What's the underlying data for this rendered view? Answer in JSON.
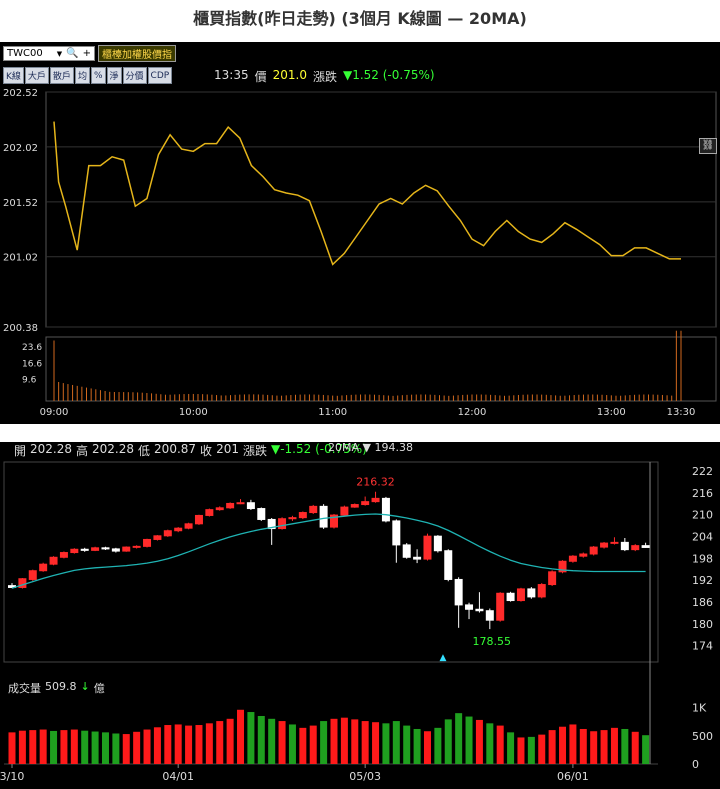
{
  "page_title": "櫃買指數(昨日走勢) (3個月 K線圖  — 20MA)",
  "intraday": {
    "symbol": "TWC00",
    "board_button": "櫃檯加權股價指",
    "tabs": [
      "K線",
      "大戶",
      "散戶",
      "均",
      "%",
      "淨",
      "分價",
      "CDP"
    ],
    "time_label": "13:35",
    "price_label": "價",
    "price_value": "201.0",
    "change_label": "漲跌",
    "change_value": "▼1.52 (-0.75%)",
    "link_icon": "link-icon"
  },
  "kline": {
    "open_label": "開",
    "open_value": "202.28",
    "high_label": "高",
    "high_value": "202.28",
    "low_label": "低",
    "low_value": "200.87",
    "close_label": "收",
    "close_value": "201",
    "change_label": "漲跌",
    "change_value": "▼-1.52 (-0.75%)",
    "ma_label": "20MA ▼ 194.38",
    "vol_label": "成交量",
    "vol_value": "509.8",
    "vol_arrow": "↓",
    "vol_unit": "億"
  },
  "chart_data": [
    {
      "type": "line",
      "title": "intraday",
      "y_ticks": [
        "202.52",
        "202.02",
        "201.52",
        "201.02",
        "200.38"
      ],
      "ylim": [
        200.38,
        202.52
      ],
      "x_ticks": [
        "09:00",
        "10:00",
        "11:00",
        "12:00",
        "13:00",
        "13:30"
      ],
      "x": [
        0,
        2,
        5,
        10,
        15,
        20,
        25,
        30,
        35,
        40,
        45,
        50,
        55,
        60,
        65,
        70,
        75,
        80,
        85,
        90,
        95,
        100,
        105,
        110,
        115,
        120,
        125,
        130,
        135,
        140,
        145,
        150,
        155,
        160,
        165,
        170,
        175,
        180,
        185,
        190,
        195,
        200,
        205,
        210,
        215,
        220,
        225,
        230,
        235,
        240,
        245,
        250,
        255,
        260,
        265,
        270
      ],
      "y": [
        202.25,
        201.7,
        201.48,
        201.08,
        201.85,
        201.85,
        201.93,
        201.9,
        201.48,
        201.55,
        201.95,
        202.13,
        202.0,
        201.98,
        202.05,
        202.05,
        202.2,
        202.1,
        201.85,
        201.75,
        201.63,
        201.6,
        201.58,
        201.53,
        201.25,
        200.95,
        201.05,
        201.2,
        201.35,
        201.5,
        201.55,
        201.5,
        201.6,
        201.67,
        201.62,
        201.48,
        201.35,
        201.18,
        201.12,
        201.25,
        201.35,
        201.25,
        201.18,
        201.15,
        201.23,
        201.33,
        201.27,
        201.2,
        201.13,
        201.03,
        201.03,
        201.1,
        201.1,
        201.05,
        201.0,
        201.0
      ],
      "volume_ticks": [
        "23.6",
        "16.6",
        "9.6"
      ],
      "volume_ylim": [
        0,
        27.5
      ],
      "volume_first": 26,
      "volume_last": 30.2
    },
    {
      "type": "candlestick",
      "title": "3個月 K線",
      "y_ticks": [
        "222",
        "216",
        "210",
        "204",
        "198",
        "192",
        "186",
        "180",
        "174"
      ],
      "ylim": [
        169.5,
        224.5
      ],
      "x_ticks": [
        "3/10",
        "04/01",
        "05/03",
        "06/01"
      ],
      "x_tick_index": [
        0,
        16,
        34,
        54
      ],
      "high_label": "216.32",
      "low_label": "178.55",
      "candles": [
        [
          190.5,
          190,
          191.2,
          189.8
        ],
        [
          190,
          192.4,
          192.6,
          189.7
        ],
        [
          192.2,
          194.6,
          194.9,
          191.8
        ],
        [
          194.6,
          196.4,
          196.8,
          194.3
        ],
        [
          196.4,
          198.3,
          198.6,
          196.1
        ],
        [
          198.3,
          199.6,
          199.9,
          198
        ],
        [
          199.6,
          200.5,
          200.8,
          199.3
        ],
        [
          200.5,
          200.2,
          200.9,
          199.8
        ],
        [
          200.2,
          200.9,
          201.2,
          200
        ],
        [
          200.9,
          200.6,
          201.2,
          200.3
        ],
        [
          200.6,
          200,
          200.9,
          199.6
        ],
        [
          200,
          201.1,
          201.3,
          199.8
        ],
        [
          201.1,
          201.3,
          201.6,
          200.7
        ],
        [
          201.3,
          203.2,
          203.4,
          201
        ],
        [
          203.2,
          204.2,
          204.4,
          202.9
        ],
        [
          204.2,
          205.6,
          205.9,
          203.9
        ],
        [
          205.6,
          206.3,
          206.6,
          205.2
        ],
        [
          206.3,
          207.5,
          207.8,
          206
        ],
        [
          207.5,
          209.8,
          210,
          207.2
        ],
        [
          209.8,
          211.4,
          211.7,
          209.5
        ],
        [
          211.4,
          211.9,
          212.3,
          211.1
        ],
        [
          211.9,
          213.1,
          213.4,
          211.6
        ],
        [
          213.1,
          213.3,
          214.3,
          212.9
        ],
        [
          213.3,
          211.7,
          214.1,
          211.3
        ],
        [
          211.7,
          208.7,
          212,
          208.3
        ],
        [
          208.7,
          206.2,
          209.1,
          201.7
        ],
        [
          206.2,
          208.9,
          209.3,
          205.9
        ],
        [
          208.9,
          209.2,
          209.7,
          208.3
        ],
        [
          209.2,
          210.6,
          210.9,
          208.8
        ],
        [
          210.6,
          212.3,
          212.7,
          210.2
        ],
        [
          212.3,
          206.6,
          212.9,
          206.1
        ],
        [
          206.6,
          209.9,
          210.2,
          206.2
        ],
        [
          209.9,
          212.1,
          212.5,
          209.5
        ],
        [
          212.1,
          212.8,
          213.1,
          211.9
        ],
        [
          212.8,
          213.6,
          215,
          212.5
        ],
        [
          213.6,
          214.5,
          216.32,
          213.3
        ],
        [
          214.5,
          208.3,
          214.9,
          207.9
        ],
        [
          208.3,
          201.7,
          208.7,
          196.8
        ],
        [
          201.7,
          198.3,
          202.2,
          197.9
        ],
        [
          198.3,
          197.8,
          200.5,
          196.7
        ],
        [
          197.8,
          204.1,
          204.8,
          197.4
        ],
        [
          204.1,
          200.1,
          204.4,
          199.6
        ],
        [
          200.1,
          192.2,
          200.5,
          191.7
        ],
        [
          192.2,
          185.2,
          192.8,
          178.9
        ],
        [
          185.2,
          184,
          185.8,
          181.3
        ],
        [
          184,
          183.6,
          188.7,
          183.1
        ],
        [
          183.6,
          181,
          184.2,
          178.55
        ],
        [
          181,
          188.4,
          188.7,
          180.6
        ],
        [
          188.4,
          186.4,
          188.8,
          186.1
        ],
        [
          186.4,
          189.6,
          189.9,
          186.1
        ],
        [
          189.6,
          187.4,
          190.1,
          186.9
        ],
        [
          187.4,
          190.8,
          191.2,
          187
        ],
        [
          190.8,
          194.3,
          194.7,
          190.4
        ],
        [
          194.3,
          197.2,
          197.5,
          193.9
        ],
        [
          197.2,
          198.6,
          198.9,
          196.8
        ],
        [
          198.6,
          199.2,
          199.6,
          198.2
        ],
        [
          199.2,
          201.1,
          201.4,
          198.8
        ],
        [
          201.1,
          202.2,
          202.5,
          200.7
        ],
        [
          202.2,
          202.4,
          203.8,
          201.8
        ],
        [
          202.4,
          200.4,
          203.6,
          200
        ],
        [
          200.4,
          201.5,
          201.9,
          200
        ],
        [
          201.5,
          201,
          202.3,
          200.9
        ]
      ],
      "ma20": [
        189.8,
        190.7,
        191.6,
        192.5,
        193.3,
        194.0,
        194.7,
        195.1,
        195.4,
        195.6,
        195.8,
        196.0,
        196.3,
        196.7,
        197.2,
        197.9,
        198.8,
        199.8,
        200.9,
        202.0,
        203.0,
        203.9,
        204.7,
        205.4,
        206.0,
        206.5,
        207.0,
        207.5,
        208.0,
        208.5,
        209.0,
        209.3,
        209.6,
        209.9,
        210.1,
        210.2,
        210.0,
        209.6,
        209.1,
        208.5,
        207.8,
        206.9,
        205.7,
        204.3,
        202.8,
        201.3,
        199.9,
        198.6,
        197.5,
        196.6,
        196.0,
        195.5,
        195.1,
        194.8,
        194.6,
        194.5,
        194.4,
        194.4,
        194.4,
        194.4,
        194.38,
        194.38
      ],
      "volume_ticks": [
        "1K",
        "500",
        "0"
      ],
      "volume_ylim": [
        0,
        1310
      ],
      "volumes": [
        560,
        590,
        600,
        610,
        585,
        600,
        610,
        590,
        575,
        560,
        540,
        530,
        570,
        610,
        650,
        690,
        700,
        680,
        690,
        720,
        760,
        800,
        960,
        920,
        850,
        800,
        760,
        700,
        640,
        680,
        760,
        800,
        820,
        790,
        760,
        740,
        720,
        760,
        680,
        620,
        580,
        640,
        790,
        900,
        840,
        780,
        720,
        680,
        560,
        470,
        480,
        520,
        600,
        660,
        700,
        620,
        580,
        600,
        640,
        620,
        570,
        509.8
      ],
      "volume_colors": [
        "r",
        "r",
        "r",
        "r",
        "g",
        "r",
        "r",
        "g",
        "g",
        "g",
        "g",
        "r",
        "r",
        "r",
        "r",
        "r",
        "r",
        "r",
        "r",
        "r",
        "r",
        "r",
        "r",
        "g",
        "g",
        "g",
        "r",
        "g",
        "r",
        "r",
        "g",
        "r",
        "r",
        "r",
        "r",
        "r",
        "g",
        "g",
        "g",
        "g",
        "r",
        "g",
        "g",
        "g",
        "g",
        "r",
        "g",
        "r",
        "g",
        "r",
        "g",
        "r",
        "r",
        "r",
        "r",
        "r",
        "r",
        "r",
        "r",
        "g",
        "r",
        "g"
      ]
    }
  ]
}
